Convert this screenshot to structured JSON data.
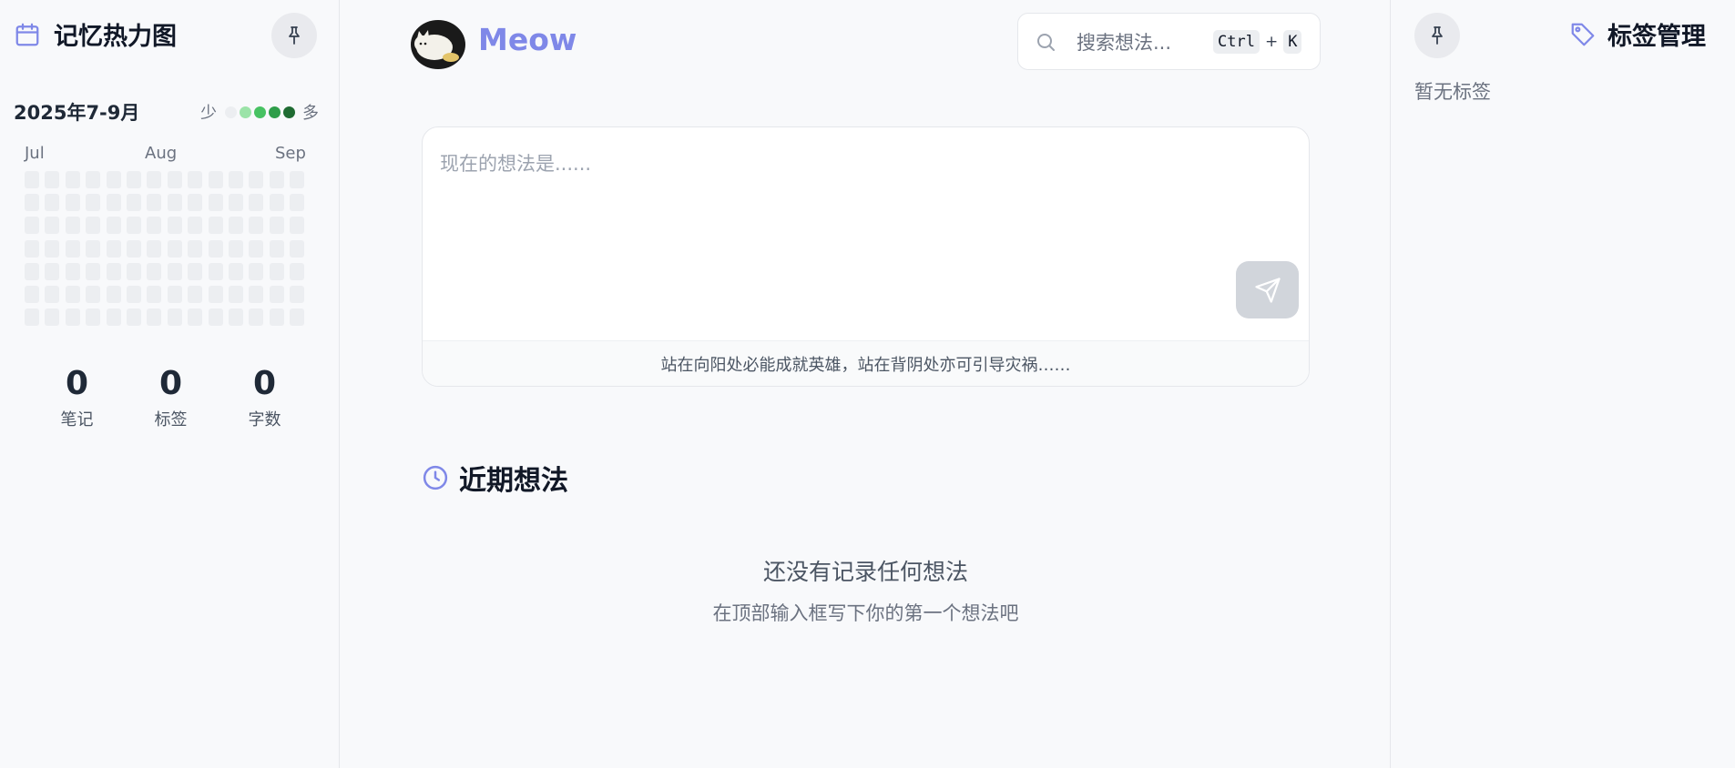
{
  "left": {
    "title": "记忆热力图",
    "range_label": "2025年7-9月",
    "legend_less": "少",
    "legend_more": "多",
    "legend_colors": [
      "#eceef1",
      "#9be3a8",
      "#47c262",
      "#2f9e4a",
      "#1f6b32"
    ],
    "months": [
      "Jul",
      "Aug",
      "Sep"
    ],
    "stats": [
      {
        "value": "0",
        "label": "笔记"
      },
      {
        "value": "0",
        "label": "标签"
      },
      {
        "value": "0",
        "label": "字数"
      }
    ]
  },
  "header": {
    "brand": "Meow",
    "search_placeholder": "搜索想法...",
    "shortcut_ctrl": "Ctrl",
    "shortcut_plus": "+",
    "shortcut_key": "K"
  },
  "composer": {
    "placeholder": "现在的想法是......",
    "quote": "站在向阳处必能成就英雄，站在背阴处亦可引导灾祸……"
  },
  "recent": {
    "title": "近期想法",
    "empty_title": "还没有记录任何想法",
    "empty_sub": "在顶部输入框写下你的第一个想法吧"
  },
  "right": {
    "title": "标签管理",
    "empty": "暂无标签"
  },
  "colors": {
    "accent": "#7f88e8",
    "heat_empty": "#eceef1"
  }
}
